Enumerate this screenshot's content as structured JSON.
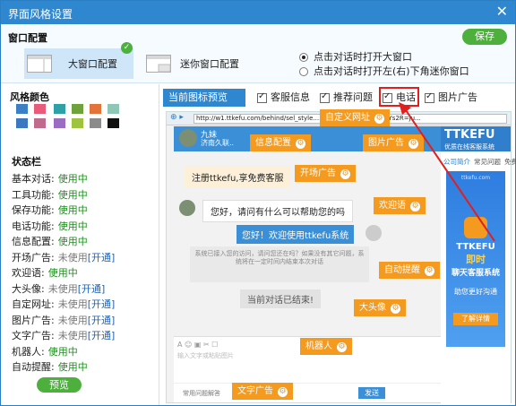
{
  "window": {
    "title": "界面风格设置",
    "close": "✕"
  },
  "window_config": {
    "heading": "窗口配置",
    "save": "保存",
    "large_label": "大窗口配置",
    "mini_label": "迷你窗口配置",
    "radio_options": [
      "点击对话时打开大窗口",
      "点击对话时打开左(右)下角迷你窗口"
    ]
  },
  "colors": {
    "heading": "风格颜色",
    "swatches": [
      "#3d7fc4",
      "#e85b7a",
      "#2ea0a8",
      "#6fa23a",
      "#e4733a",
      "#8ec7b8",
      "#3b78c0",
      "#c06a8e",
      "#9a6dc2",
      "#9ec33e",
      "#8b8b8b",
      "#111111"
    ]
  },
  "status": {
    "heading": "状态栏",
    "rows": [
      {
        "label": "基本对话:",
        "value": "使用中",
        "state": "on",
        "link": ""
      },
      {
        "label": "工具功能:",
        "value": "使用中",
        "state": "on",
        "link": ""
      },
      {
        "label": "保存功能:",
        "value": "使用中",
        "state": "on",
        "link": ""
      },
      {
        "label": "电话功能:",
        "value": "使用中",
        "state": "on",
        "link": ""
      },
      {
        "label": "信息配置:",
        "value": "使用中",
        "state": "on",
        "link": ""
      },
      {
        "label": "开场广告:",
        "value": "未使用",
        "state": "off",
        "link": "[开通]"
      },
      {
        "label": "欢迎语:",
        "value": "使用中",
        "state": "on",
        "link": ""
      },
      {
        "label": "大头像:",
        "value": "未使用",
        "state": "off",
        "link": "[开通]"
      },
      {
        "label": "自定网址:",
        "value": "未使用",
        "state": "off",
        "link": "[开通]"
      },
      {
        "label": "图片广告:",
        "value": "未使用",
        "state": "off",
        "link": "[开通]"
      },
      {
        "label": "文字广告:",
        "value": "未使用",
        "state": "off",
        "link": "[开通]"
      },
      {
        "label": "机器人:",
        "value": "使用中",
        "state": "on",
        "link": ""
      },
      {
        "label": "自动提醒:",
        "value": "使用中",
        "state": "on",
        "link": ""
      }
    ],
    "preview_button": "预览"
  },
  "preview": {
    "tab": "当前图标预览",
    "options": [
      "客服信息",
      "推荐问题",
      "电话",
      "图片广告"
    ],
    "url": "http://w1.ttkefu.com/behind/sel_style.......sNi6lLoanceshi3&l5Ys2R=ju...",
    "agent_name": "九妹",
    "agent_sub": "济南久联..",
    "brand": "TTKEFU",
    "brand_sub": "优质在线客服系统",
    "side_tabs": [
      "公司简介",
      "常见问题",
      "免费电话"
    ],
    "ad_brand": "TTKEFU",
    "ad_line1": "即时",
    "ad_line2": "聊天客服系统",
    "ad_line3": "助您更好沟通",
    "ad_button": "了解详情",
    "ad_small": "ttkefu.com",
    "open_ad": "注册ttkefu,享免费客服",
    "greeting": "您好，请问有什么可以帮助您的吗",
    "welcome": "您好！欢迎使用ttkefu系统",
    "system_msg": "系统已接入您的访问，请问您还在吗？如果没有其它问题，系统将在一定时间内结束本次对话",
    "ended": "当前对话已结束!",
    "input_hint": "输入文字或粘贴图片",
    "send": "发送",
    "text_ad": "常用问题解答",
    "tags": [
      "自定义网址",
      "信息配置",
      "图片广告",
      "开场广告",
      "欢迎语",
      "自动提醒",
      "大头像",
      "机器人",
      "文字广告"
    ]
  }
}
